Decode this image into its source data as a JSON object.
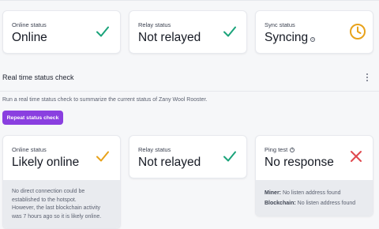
{
  "top_cards": [
    {
      "label": "Online status",
      "value": "Online",
      "icon": "check-icon",
      "icon_color": "#1aa37a"
    },
    {
      "label": "Relay status",
      "value": "Not relayed",
      "icon": "check-icon",
      "icon_color": "#1aa37a"
    },
    {
      "label": "Sync status",
      "value": "Syncing",
      "icon": "clock-icon",
      "icon_color": "#e8a21a"
    }
  ],
  "section": {
    "title": "Real time status check",
    "description": "Run a real time status check to summarize the current status of Zany Wool Rooster.",
    "button_label": "Repeat status check"
  },
  "check_cards": [
    {
      "label": "Online status",
      "value": "Likely online",
      "icon": "check-icon",
      "icon_color": "#e8a21a",
      "note_1": "No direct connection could be established to the hotspot.",
      "note_2": "However, the last blockchain activity was 7 hours ago so it is likely online."
    },
    {
      "label": "Relay status",
      "value": "Not relayed",
      "icon": "check-icon",
      "icon_color": "#1aa37a"
    },
    {
      "label": "Ping test",
      "value": "No response",
      "icon": "x-icon",
      "icon_color": "#e0484e",
      "miner_key": "Miner:",
      "miner_value": "No listen address found",
      "blockchain_key": "Blockchain:",
      "blockchain_value": "No listen address found"
    }
  ],
  "colors": {
    "accent": "#8a3fe0",
    "success": "#1aa37a",
    "warning": "#e8a21a",
    "error": "#e0484e"
  }
}
